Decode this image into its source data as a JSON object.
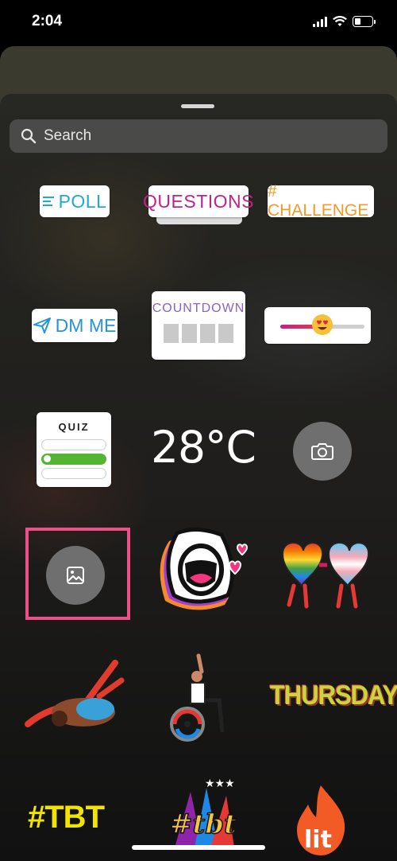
{
  "status": {
    "time": "2:04"
  },
  "search": {
    "placeholder": "Search"
  },
  "stickers": {
    "poll": "POLL",
    "questions": "QUESTIONS",
    "challenge": "# CHALLENGE",
    "dm_me": "DM ME",
    "countdown": "COUNTDOWN",
    "quiz": "QUIZ",
    "temperature": "28°C",
    "thursday": "THURSDAY",
    "tbt": "#TBT",
    "tbt_script": "#tbt",
    "lit": "lit"
  },
  "slider_sticker": {
    "level": 0.48,
    "emoji": "heart-eyes"
  },
  "colors": {
    "poll": "#1fa9d6",
    "questions": "#c2208f",
    "challenge": "#f29a27",
    "dm_me": "#2595d8",
    "countdown": "#8a61c9",
    "quiz_selected": "#55b533",
    "highlight": "#ef4f89"
  }
}
